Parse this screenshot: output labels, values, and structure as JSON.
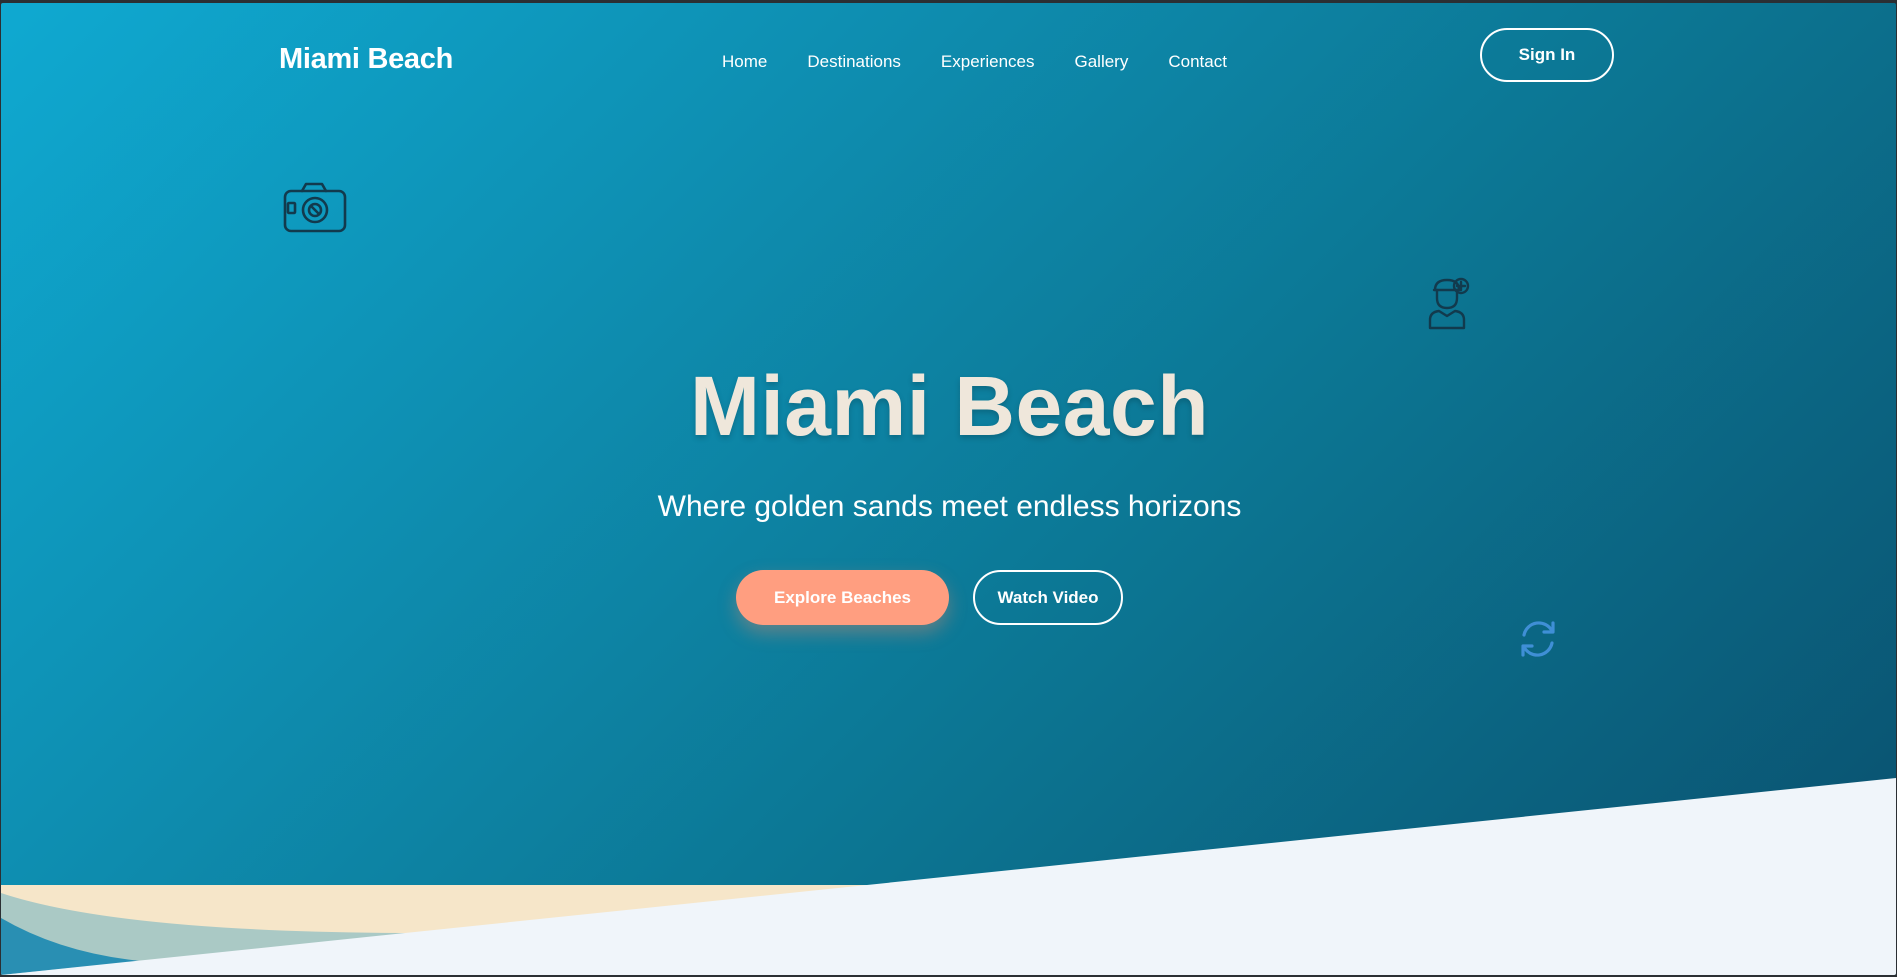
{
  "nav": {
    "logo": "Miami Beach",
    "links": [
      "Home",
      "Destinations",
      "Experiences",
      "Gallery",
      "Contact"
    ],
    "sign_in": "Sign In"
  },
  "hero": {
    "title": "Miami Beach",
    "subtitle": "Where golden sands meet endless horizons",
    "primary_cta": "Explore Beaches",
    "secondary_cta": "Watch Video"
  },
  "decor": {
    "icons": [
      "camera-icon",
      "person-add-icon",
      "refresh-icon"
    ]
  },
  "colors": {
    "gradient_start": "#0fa9d1",
    "gradient_end": "#0a4f6d",
    "accent": "#ff9e80",
    "title": "#efe7db",
    "sand": "#f6e6c9",
    "foam": "#f0f5fa"
  }
}
